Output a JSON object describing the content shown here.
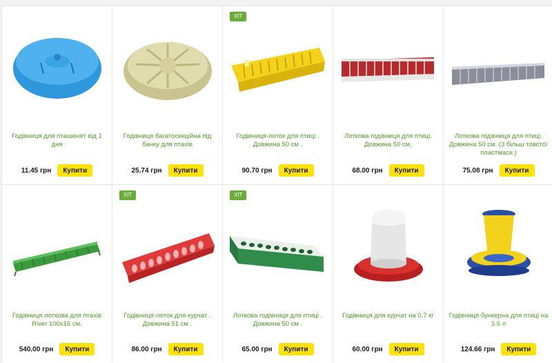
{
  "products": [
    {
      "title": "Годівниця для пташенят від 1 дня",
      "price": "11.45 грн",
      "buy_label": "Купити",
      "badge": "",
      "icon": "blue-round-feeder-icon"
    },
    {
      "title": "Годівниця багатосекційна під банку для птахів",
      "price": "25.74 грн",
      "buy_label": "Купити",
      "badge": "",
      "icon": "beige-multisection-feeder-icon"
    },
    {
      "title": "Годівниця-лоток для птиці . Довжина 50 см .",
      "price": "90.70 грн",
      "buy_label": "Купити",
      "badge": "ХІТ",
      "icon": "yellow-trough-feeder-icon"
    },
    {
      "title": "Лоткова годівниця для птиці. Довжина 50 см.",
      "price": "68.00 грн",
      "buy_label": "Купити",
      "badge": "",
      "icon": "red-trough-feeder-icon"
    },
    {
      "title": "Лоткова годівниця для птиці. Довжина 50 см. (3 більш товстої пластмаси.)",
      "price": "75.08 грн",
      "buy_label": "Купити",
      "badge": "",
      "icon": "grey-trough-feeder-icon"
    },
    {
      "title": "Годівниця лоткова для птахів River 100х16 см.",
      "price": "540.00 грн",
      "buy_label": "Купити",
      "badge": "",
      "icon": "green-long-trough-icon"
    },
    {
      "title": "Годівниця-лоток для курчат . Довжина 51 см .",
      "price": "86.00 грн",
      "buy_label": "Купити",
      "badge": "ХІТ",
      "icon": "red-hole-trough-icon"
    },
    {
      "title": "Лоткова годівниця для птиці . Довжина 50 см .",
      "price": "65.00 грн",
      "buy_label": "Купити",
      "badge": "ХІТ",
      "icon": "green-hole-trough-icon"
    },
    {
      "title": "Годівниця для курчат на 0,7 кг",
      "price": "60.00 грн",
      "buy_label": "Купити",
      "badge": "",
      "icon": "red-white-bunker-feeder-icon"
    },
    {
      "title": "Годівниця бункерна для птиці на 3.5 л",
      "price": "124.66 грн",
      "buy_label": "Купити",
      "badge": "",
      "icon": "yellow-blue-bunker-feeder-icon"
    }
  ],
  "colors": {
    "title_green": "#4f9a2a",
    "button_yellow": "#ffe20a",
    "badge_green": "#6aac3a"
  }
}
